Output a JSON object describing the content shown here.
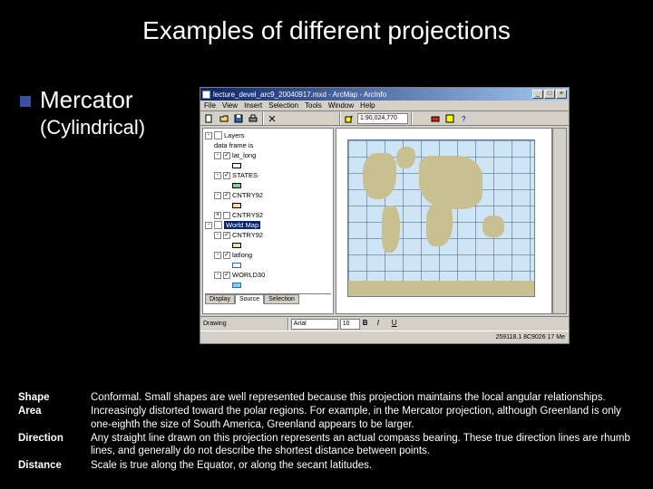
{
  "slide": {
    "title": "Examples of different projections",
    "projection_name": "Mercator",
    "projection_subtype": "(Cylindrical)"
  },
  "app": {
    "title": "lecture_devel_arc9_20040917.mxd - ArcMap - ArcInfo",
    "menus": [
      "File",
      "View",
      "Insert",
      "Selection",
      "Tools",
      "Window",
      "Help"
    ],
    "scale": "1:90,024,770",
    "status_coords": "259118.1 8C9026 17 Me",
    "toc": {
      "tabs": [
        "Display",
        "Source",
        "Selection"
      ],
      "group1": "Layers",
      "group1_sub": "data frame is",
      "item_latlong": "lat_long",
      "item_states": "STATES",
      "item_cntry92_a": "CNTRY92",
      "item_cntry92_b": "CNTRY92",
      "group2": "World Map",
      "item_cntry92_c": "CNTRY92",
      "item_latlong2": "latlong",
      "item_world30": "WORLD30"
    },
    "bottom": {
      "label1": "Drawing",
      "font": "Arial",
      "size": "10"
    }
  },
  "properties": [
    {
      "label": "Shape",
      "text": "Conformal. Small shapes are well represented because this projection maintains the local angular relationships."
    },
    {
      "label": "Area",
      "text": "Increasingly distorted toward the polar regions. For example, in the Mercator projection, although Greenland is only one-eighth the size of South America, Greenland appears to be larger."
    },
    {
      "label": "Direction",
      "text": "Any straight line drawn on this projection represents an actual compass bearing. These true direction lines are rhumb lines, and generally do not describe the shortest distance between points."
    },
    {
      "label": "Distance",
      "text": "Scale is true along the Equator, or along the secant latitudes."
    }
  ]
}
